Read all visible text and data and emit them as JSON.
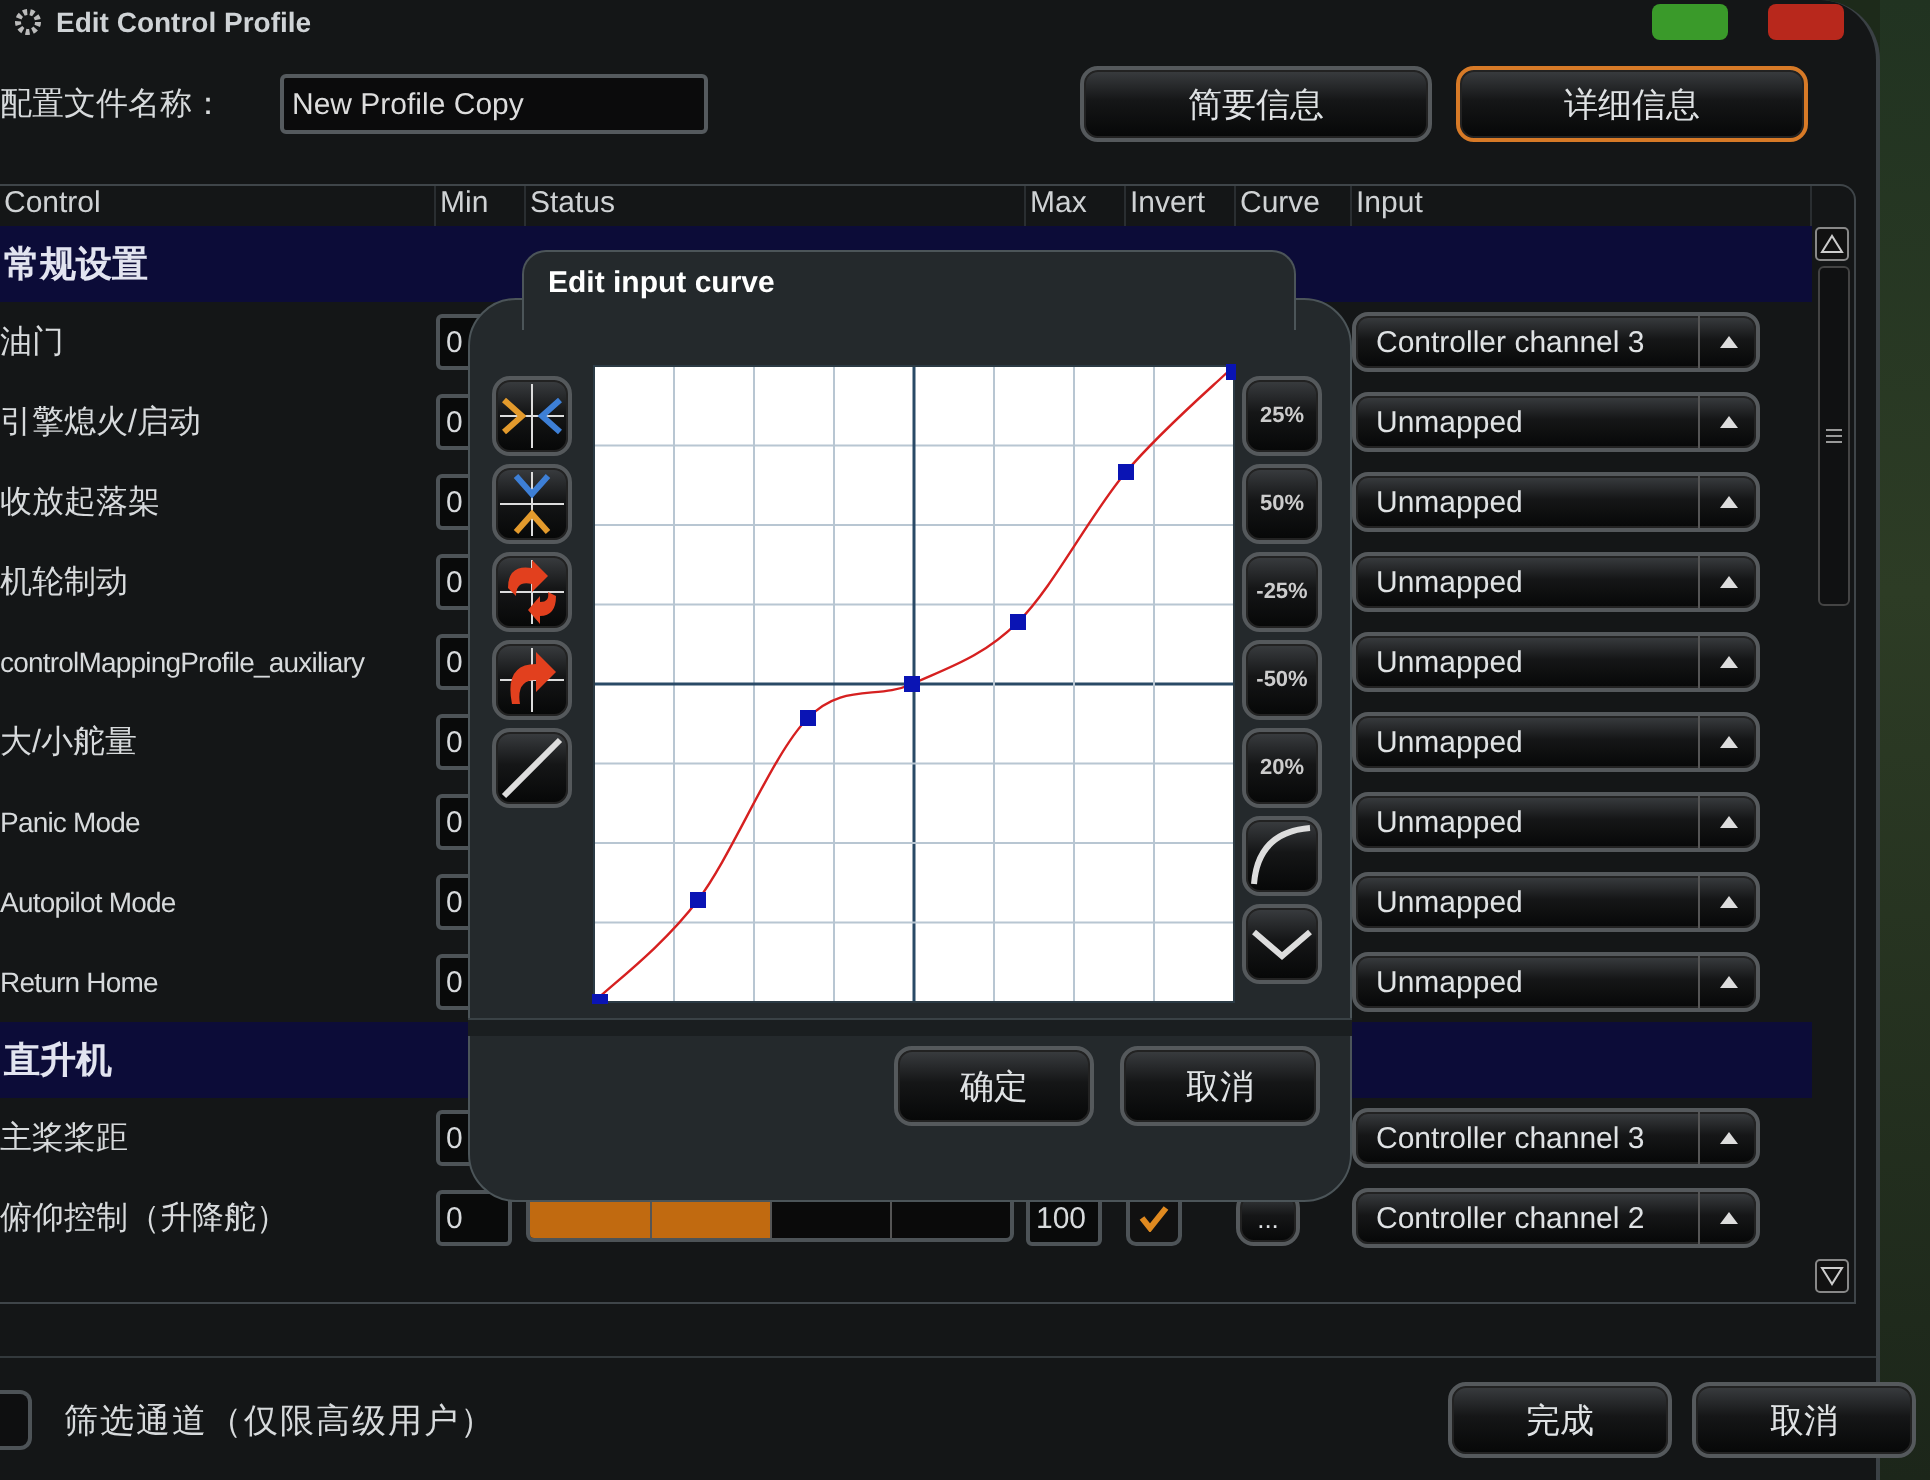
{
  "window": {
    "title": "Edit Control Profile"
  },
  "profile_name": {
    "label": "配置文件名称：",
    "value": "New Profile Copy"
  },
  "view_tabs": [
    {
      "label": "简要信息",
      "selected": false
    },
    {
      "label": "详细信息",
      "selected": true
    }
  ],
  "table": {
    "columns": [
      "Control",
      "Min",
      "Status",
      "Max",
      "Invert",
      "Curve",
      "Input"
    ],
    "rows": [
      {
        "kind": "group",
        "label": "常规设置"
      },
      {
        "kind": "control",
        "name": "油门",
        "min": "0",
        "input": "Controller channel 3"
      },
      {
        "kind": "control",
        "name": "引擎熄火/启动",
        "min": "0",
        "input": "Unmapped"
      },
      {
        "kind": "control",
        "name": "收放起落架",
        "min": "0",
        "input": "Unmapped"
      },
      {
        "kind": "control",
        "name": "机轮制动",
        "min": "0",
        "input": "Unmapped"
      },
      {
        "kind": "control",
        "name": "controlMappingProfile_auxiliary",
        "min": "0",
        "input": "Unmapped"
      },
      {
        "kind": "control",
        "name": "大/小舵量",
        "min": "0",
        "input": "Unmapped"
      },
      {
        "kind": "control",
        "name": "Panic Mode",
        "min": "0",
        "input": "Unmapped"
      },
      {
        "kind": "control",
        "name": "Autopilot Mode",
        "min": "0",
        "input": "Unmapped"
      },
      {
        "kind": "control",
        "name": "Return Home",
        "min": "0",
        "input": "Unmapped"
      },
      {
        "kind": "group",
        "label": "直升机"
      },
      {
        "kind": "control",
        "name": "主桨桨距",
        "min": "0",
        "input": "Controller channel 3"
      },
      {
        "kind": "control",
        "name": "俯仰控制（升降舵）",
        "min": "0",
        "level": 0.5,
        "max": "100",
        "invert": true,
        "curve": "...",
        "input": "Controller channel 2"
      }
    ]
  },
  "curve_dialog": {
    "title": "Edit input curve",
    "preset_buttons": [
      "25%",
      "50%",
      "-25%",
      "-50%",
      "20%"
    ],
    "buttons": [
      "确定",
      "取消"
    ]
  },
  "footer": {
    "filter": {
      "label": "筛选通道（仅限高级用户）",
      "checked": false
    },
    "buttons": [
      "完成",
      "取消"
    ]
  }
}
